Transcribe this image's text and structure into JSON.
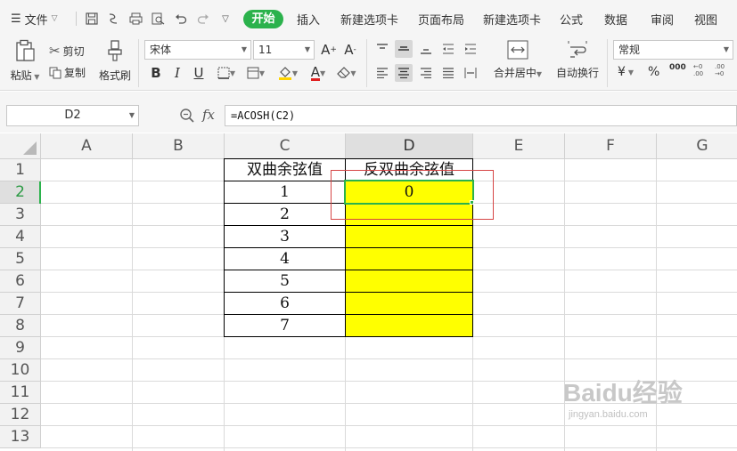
{
  "menubar": {
    "file_label": "文件",
    "tabs": [
      "开始",
      "插入",
      "新建选项卡",
      "页面布局",
      "新建选项卡",
      "公式",
      "数据",
      "审阅",
      "视图"
    ]
  },
  "ribbon": {
    "paste_label": "粘贴",
    "cut_label": "剪切",
    "copy_label": "复制",
    "format_painter_label": "格式刷",
    "font_name": "宋体",
    "font_size": "11",
    "merge_label": "合并居中",
    "wrap_label": "自动换行",
    "number_format": "常规",
    "currency_symbol": "¥",
    "percent_symbol": "%",
    "thousands_symbol": "000"
  },
  "formula_bar": {
    "name_box": "D2",
    "fx_label": "fx",
    "formula": "=ACOSH(C2)"
  },
  "grid": {
    "columns": [
      "A",
      "B",
      "C",
      "D",
      "E",
      "F",
      "G"
    ],
    "selected_column": "D",
    "rows": [
      "1",
      "2",
      "3",
      "4",
      "5",
      "6",
      "7",
      "8",
      "9",
      "10",
      "11",
      "12",
      "13"
    ],
    "selected_row": "2",
    "header_c": "双曲余弦值",
    "header_d": "反双曲余弦值",
    "c_values": [
      "1",
      "2",
      "3",
      "4",
      "5",
      "6",
      "7"
    ],
    "d_values": [
      "0",
      "",
      "",
      "",
      "",
      "",
      ""
    ],
    "highlight_color": "#ffff00",
    "accent_color": "#2bb24c"
  },
  "watermark": {
    "brand": "Baidu经验",
    "url": "jingyan.baidu.com"
  }
}
